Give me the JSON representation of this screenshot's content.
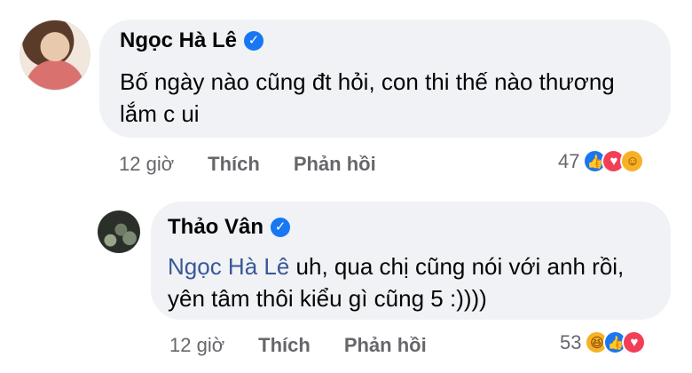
{
  "comments": [
    {
      "author": "Ngọc Hà Lê",
      "text": "Bố ngày nào cũng đt hỏi, con thi thế nào thương lắm c ui",
      "time": "12 giờ",
      "like_label": "Thích",
      "reply_label": "Phản hồi",
      "reaction_count": "47",
      "reactions": [
        "like",
        "love",
        "care"
      ]
    },
    {
      "author": "Thảo Vân",
      "mention": "Ngọc Hà Lê",
      "text": "uh, qua chị cũng nói với anh rồi, yên tâm thôi kiểu gì cũng 5 :))))",
      "time": "12 giờ",
      "like_label": "Thích",
      "reply_label": "Phản hồi",
      "reaction_count": "53",
      "reactions": [
        "haha",
        "like",
        "love"
      ]
    }
  ],
  "icons": {
    "verified": "✓",
    "like": "👍",
    "love": "♥",
    "care": "☺",
    "haha": "😆"
  },
  "colors": {
    "bubble": "#f0f2f5",
    "verified": "#1877f2",
    "mention": "#385898",
    "meta": "#65676b"
  }
}
